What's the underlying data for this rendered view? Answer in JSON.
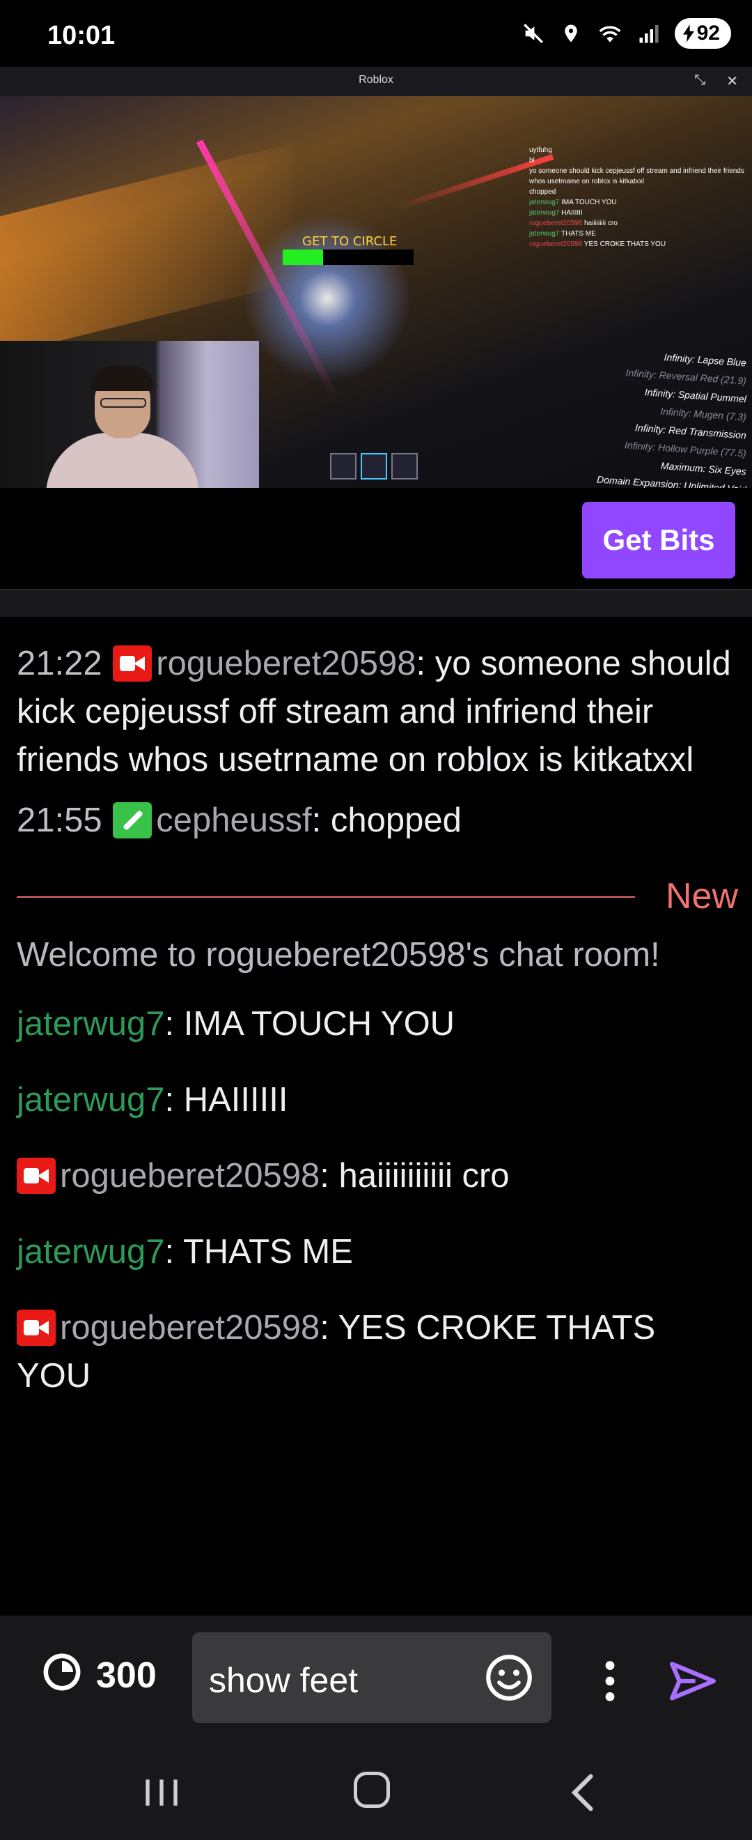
{
  "status_bar": {
    "time": "10:01",
    "battery": "92"
  },
  "video": {
    "window_title": "Roblox",
    "game_prompt": "GET TO CIRCLE",
    "ingame_chat": [
      {
        "user": "",
        "text": "uytfuhg"
      },
      {
        "user": "",
        "text": "bl"
      },
      {
        "user": "",
        "text": "yo someone should kick cepjeussf off stream and infriend their friends whos usetmame on roblox is kitkatxxl"
      },
      {
        "user": "",
        "text": "chopped"
      },
      {
        "user": "jaterwug7",
        "text": "IMA TOUCH YOU"
      },
      {
        "user": "jaterwug7",
        "text": "HAIIIIII"
      },
      {
        "user": "rogueberet20598",
        "text": "haiiiiiiiii cro"
      },
      {
        "user": "jaterwug7",
        "text": "THATS ME"
      },
      {
        "user": "rogueberet20598",
        "text": "YES CROKE THATS YOU"
      }
    ],
    "abilities": [
      {
        "label": "Infinity: Lapse Blue",
        "dim": false
      },
      {
        "label": "Infinity: Reversal Red (21.9)",
        "dim": true
      },
      {
        "label": "Infinity: Spatial Pummel",
        "dim": false
      },
      {
        "label": "Infinity: Mugen (7.3)",
        "dim": true
      },
      {
        "label": "Infinity: Red Transmission",
        "dim": false
      },
      {
        "label": "Infinity: Hollow Purple (77.5)",
        "dim": true
      },
      {
        "label": "Maximum: Six Eyes",
        "dim": false
      },
      {
        "label": "Domain Expansion: Unlimited Void",
        "dim": false
      }
    ]
  },
  "get_bits_label": "Get Bits",
  "chat": {
    "messages_before": [
      {
        "time": "21:22",
        "badge": "broadcaster",
        "user": "rogueberet20598",
        "text": "yo someone should kick cepjeussf off stream and infriend their friends whos usetrname on roblox is kitkatxxl"
      },
      {
        "time": "21:55",
        "badge": "moderator",
        "user": "cepheussf",
        "text": "chopped"
      }
    ],
    "new_label": "New",
    "welcome": "Welcome to rogueberet20598's chat room!",
    "messages_after": [
      {
        "badge": "",
        "user": "jaterwug7",
        "text": "IMA TOUCH YOU"
      },
      {
        "badge": "",
        "user": "jaterwug7",
        "text": "HAIIIIII"
      },
      {
        "badge": "broadcaster",
        "user": "rogueberet20598",
        "text": "haiiiiiiiiii cro"
      },
      {
        "badge": "",
        "user": "jaterwug7",
        "text": "THATS ME"
      },
      {
        "badge": "broadcaster",
        "user": "rogueberet20598",
        "text": "YES CROKE THATS YOU"
      }
    ]
  },
  "input_bar": {
    "channel_points": "300",
    "message_value": "show feet",
    "icons": [
      "channel-points-icon",
      "emoji-icon",
      "more-icon",
      "send-icon"
    ]
  },
  "nav_bar": {
    "icons": [
      "recents-icon",
      "home-icon",
      "back-icon"
    ]
  }
}
